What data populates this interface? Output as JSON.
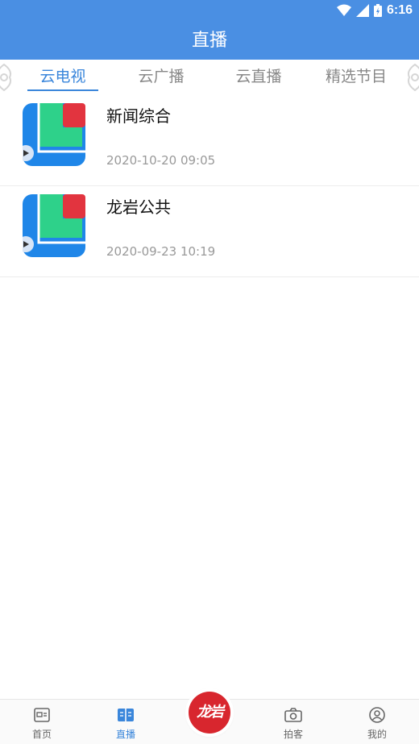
{
  "status": {
    "time": "6:16"
  },
  "header": {
    "title": "直播"
  },
  "tabs": [
    {
      "label": "云电视",
      "active": true
    },
    {
      "label": "云广播",
      "active": false
    },
    {
      "label": "云直播",
      "active": false
    },
    {
      "label": "精选节目",
      "active": false
    }
  ],
  "items": [
    {
      "title": "新闻综合",
      "time": "2020-10-20 09:05"
    },
    {
      "title": "龙岩公共",
      "time": "2020-09-23 10:19"
    }
  ],
  "bottom_nav": [
    {
      "label": "首页",
      "icon": "news-icon",
      "active": false
    },
    {
      "label": "直播",
      "icon": "book-icon",
      "active": true
    },
    {
      "label": "龙岩",
      "icon": "logo"
    },
    {
      "label": "拍客",
      "icon": "camera-icon",
      "active": false
    },
    {
      "label": "我的",
      "icon": "user-icon",
      "active": false
    }
  ],
  "colors": {
    "brand": "#4a8fe3",
    "accent": "#3a86db",
    "logo_red": "#d8262e"
  }
}
